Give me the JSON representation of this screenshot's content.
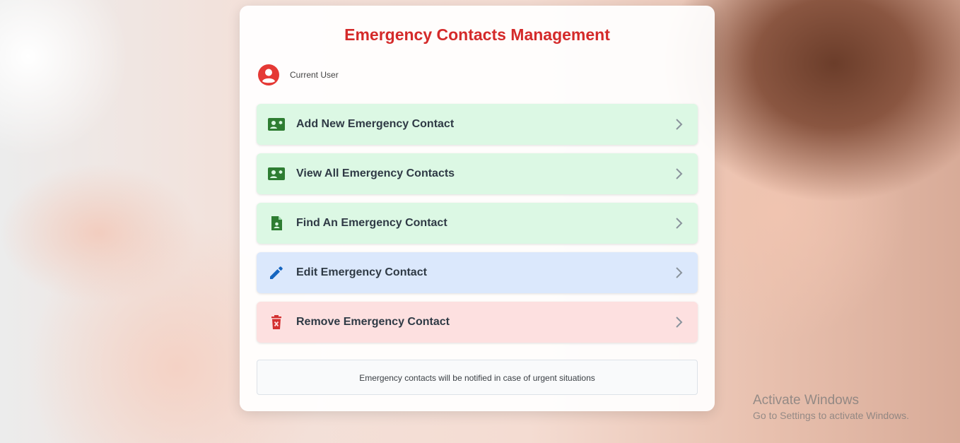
{
  "page": {
    "title": "Emergency Contacts Management"
  },
  "user": {
    "label": "Current User",
    "icon": "user-circle-icon"
  },
  "menu": [
    {
      "label": "Add New Emergency Contact",
      "icon": "contact-card-icon",
      "variant": "green"
    },
    {
      "label": "View All Emergency Contacts",
      "icon": "contact-card-icon",
      "variant": "green"
    },
    {
      "label": "Find An Emergency Contact",
      "icon": "contact-file-icon",
      "variant": "green"
    },
    {
      "label": "Edit Emergency Contact",
      "icon": "pencil-icon",
      "variant": "blue"
    },
    {
      "label": "Remove Emergency Contact",
      "icon": "trash-icon",
      "variant": "red"
    }
  ],
  "footer_note": "Emergency contacts will be notified in case of urgent situations",
  "os_watermark": {
    "title": "Activate Windows",
    "subtitle": "Go to Settings to activate Windows."
  },
  "colors": {
    "title": "#d42a2a",
    "green_icon": "#2e7d32",
    "blue_icon": "#1565c0",
    "red_icon": "#d32f2f",
    "green_bg": "#dcf8e4",
    "blue_bg": "#dbe8fc",
    "red_bg": "#fde0e0"
  }
}
